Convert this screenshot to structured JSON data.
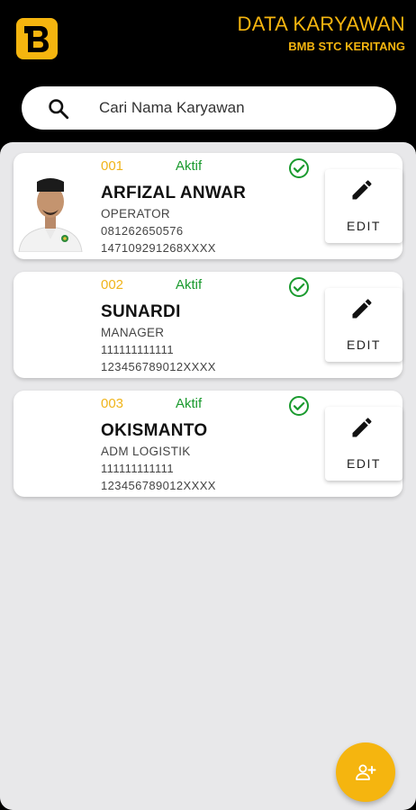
{
  "header": {
    "title": "DATA KARYAWAN",
    "subtitle": "BMB STC KERITANG",
    "logo_icon": "b-logo-icon",
    "accent_color": "#f5b50f"
  },
  "search": {
    "placeholder": "Cari Nama Karyawan",
    "icon": "search-icon"
  },
  "employees": [
    {
      "code": "001",
      "status": "Aktif",
      "name": "ARFIZAL ANWAR",
      "role": "OPERATOR",
      "phone": "081262650576",
      "id_number": "147109291268XXXX",
      "has_photo": true,
      "edit_label": "EDIT"
    },
    {
      "code": "002",
      "status": "Aktif",
      "name": "SUNARDI",
      "role": "MANAGER",
      "phone": "111111111111",
      "id_number": "123456789012XXXX",
      "has_photo": false,
      "edit_label": "EDIT"
    },
    {
      "code": "003",
      "status": "Aktif",
      "name": "OKISMANTO",
      "role": "ADM LOGISTIK",
      "phone": "111111111111",
      "id_number": "123456789012XXXX",
      "has_photo": false,
      "edit_label": "EDIT"
    }
  ],
  "colors": {
    "code": "#f0b41a",
    "status_active": "#1a9a2e",
    "fab": "#f5b50f"
  },
  "fab": {
    "icon": "add-person-icon"
  }
}
